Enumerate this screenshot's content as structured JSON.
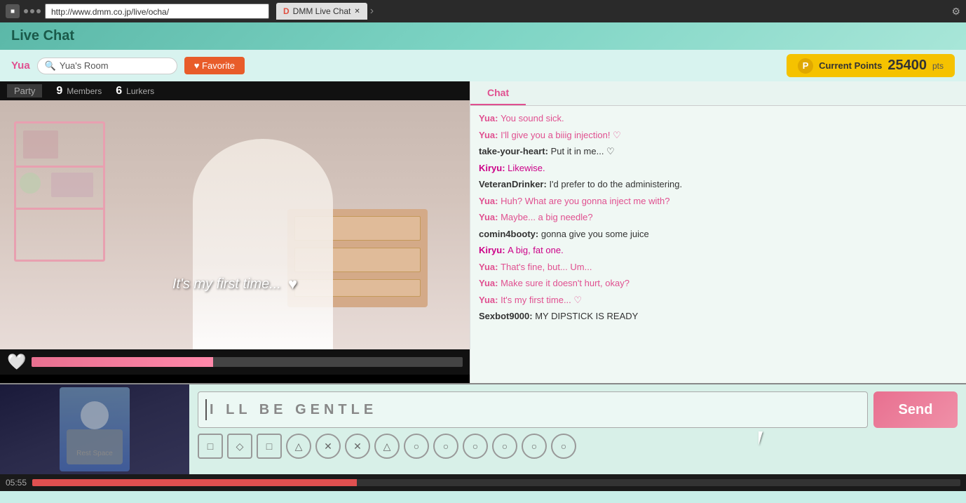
{
  "browser": {
    "url": "http://www.dmm.co.jp/live/ocha/",
    "tab_title": "DMM Live Chat",
    "window_title": "DMM Live Chat"
  },
  "header": {
    "title": "Live Chat"
  },
  "sub_header": {
    "streamer": "Yua",
    "room_label": "Yua's Room",
    "favorite_label": "♥ Favorite",
    "points_label": "Current Points",
    "points_value": "25400",
    "points_unit": "pts",
    "points_icon": "P"
  },
  "stream": {
    "party_label": "Party",
    "members_count": "9",
    "members_label": "Members",
    "lurkers_count": "6",
    "lurkers_label": "Lurkers",
    "overlay_text": "It's my first time...",
    "overlay_heart": "♥"
  },
  "chat": {
    "tab_label": "Chat",
    "messages": [
      {
        "user": "Yua",
        "text": "You sound sick.",
        "type": "pink"
      },
      {
        "user": "Yua",
        "text": "I'll give you a biiig injection! ♡",
        "type": "pink"
      },
      {
        "user": "take-your-heart",
        "text": "Put it in me... ♡",
        "type": "dark"
      },
      {
        "user": "Kiryu",
        "text": "Likewise.",
        "type": "magenta"
      },
      {
        "user": "VeteranDrinker",
        "text": "I'd prefer to do the administering.",
        "type": "dark"
      },
      {
        "user": "Yua",
        "text": "Huh? What are you gonna inject me with?",
        "type": "pink"
      },
      {
        "user": "Yua",
        "text": "Maybe... a big needle?",
        "type": "pink"
      },
      {
        "user": "comin4booty",
        "text": "gonna give you some juice",
        "type": "dark"
      },
      {
        "user": "Kiryu",
        "text": "A big, fat one.",
        "type": "magenta"
      },
      {
        "user": "Yua",
        "text": "That's fine, but... Um...",
        "type": "pink"
      },
      {
        "user": "Yua",
        "text": "Make sure it doesn't hurt, okay?",
        "type": "pink"
      },
      {
        "user": "Yua",
        "text": "It's my first time... ♡",
        "type": "pink"
      },
      {
        "user": "Sexbot9000",
        "text": "MY DIPSTICK IS READY",
        "type": "dark"
      }
    ]
  },
  "input": {
    "text": "I LL  BE  GENTLE",
    "placeholder": "I LL BE GENTLE",
    "send_label": "Send",
    "timer": "05:55"
  },
  "gamepad_buttons": [
    {
      "symbol": "□",
      "shape": "square"
    },
    {
      "symbol": "◇",
      "shape": "square"
    },
    {
      "symbol": "□",
      "shape": "square"
    },
    {
      "symbol": "△",
      "shape": "circle"
    },
    {
      "symbol": "✕",
      "shape": "circle"
    },
    {
      "symbol": "✕",
      "shape": "circle"
    },
    {
      "symbol": "△",
      "shape": "circle"
    },
    {
      "symbol": "○",
      "shape": "circle"
    },
    {
      "symbol": "○",
      "shape": "circle"
    },
    {
      "symbol": "○",
      "shape": "circle"
    },
    {
      "symbol": "○",
      "shape": "circle"
    },
    {
      "symbol": "○",
      "shape": "circle"
    },
    {
      "symbol": "○",
      "shape": "circle"
    }
  ]
}
